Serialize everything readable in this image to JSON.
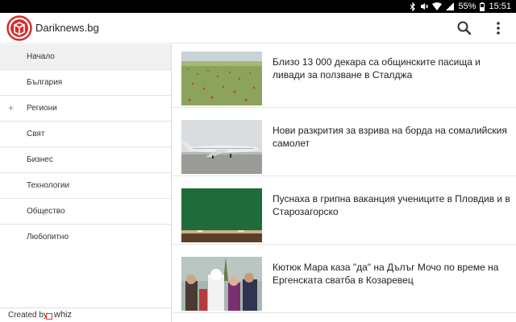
{
  "status_bar": {
    "battery": "55%",
    "time": "15:51"
  },
  "app_bar": {
    "title": "Dariknews.bg"
  },
  "sidebar": {
    "items": [
      {
        "label": "Начало",
        "active": true,
        "expandable": false
      },
      {
        "label": "България",
        "active": false,
        "expandable": false
      },
      {
        "label": "Региони",
        "active": false,
        "expandable": true,
        "expand_symbol": "+"
      },
      {
        "label": "Свят",
        "active": false,
        "expandable": false
      },
      {
        "label": "Бизнес",
        "active": false,
        "expandable": false
      },
      {
        "label": "Технологии",
        "active": false,
        "expandable": false
      },
      {
        "label": "Общество",
        "active": false,
        "expandable": false
      },
      {
        "label": "Любопитно",
        "active": false,
        "expandable": false
      }
    ],
    "footer": {
      "created_by": "Created by",
      "brand": "whiz"
    }
  },
  "articles": [
    {
      "headline": "Близо 13 000 декара са общинските пасища и ливади за ползване в Сталджа",
      "thumb": "meadow-with-poppies"
    },
    {
      "headline": "Нови разкрития за взрива на борда на сомалийския самолет",
      "thumb": "airplane-on-runway"
    },
    {
      "headline": "Пуснаха в грипна ваканция учениците в Пловдив и в Старозагорско",
      "thumb": "classroom-chalkboard"
    },
    {
      "headline": "Кютюк Мара каза \"да\" на Дълъг Мочо по време на Ергенската сватба в Козаревец",
      "thumb": "wedding-crowd"
    }
  ],
  "colors": {
    "brand_red": "#d32f2f",
    "active_nav_bg": "#f0f0f0",
    "status_bar_bg": "#000000"
  }
}
